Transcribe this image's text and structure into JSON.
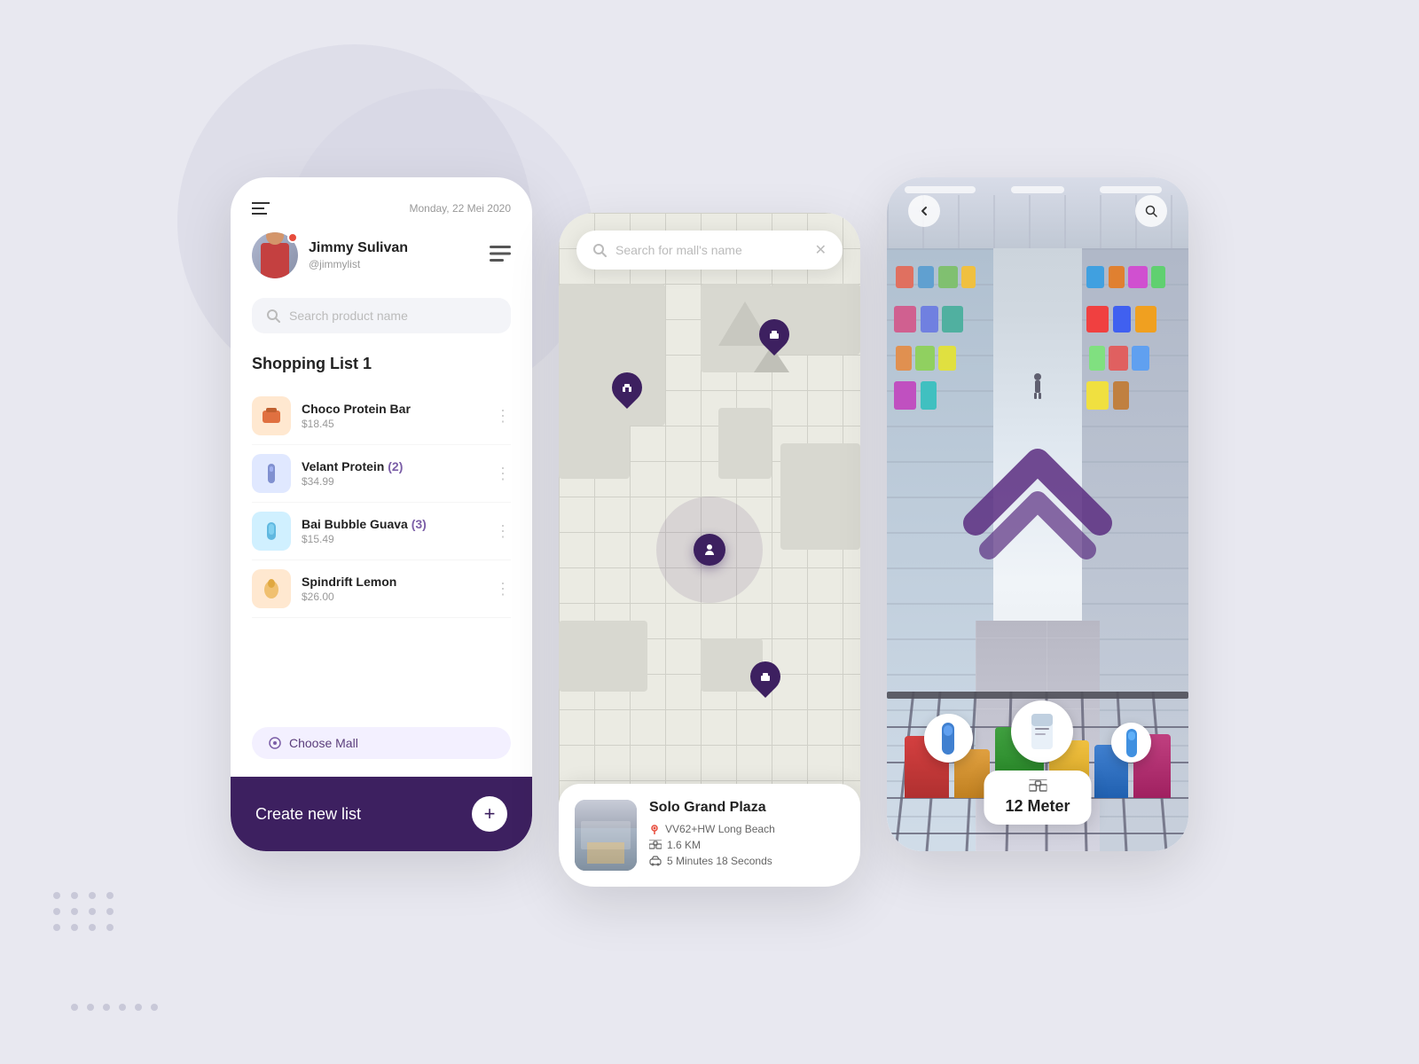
{
  "background": {
    "color": "#e8e8f0"
  },
  "phone1": {
    "header": {
      "hamburger_label": "menu",
      "date": "Monday, 22 Mei 2020"
    },
    "user": {
      "name": "Jimmy Sulivan",
      "handle": "@jimmylist"
    },
    "search": {
      "placeholder": "Search product name"
    },
    "shopping_list": {
      "title": "Shopping List 1",
      "items": [
        {
          "name": "Choco Protein Bar",
          "price": "$18.45",
          "count": null,
          "emoji": "🍫",
          "bg": "#ffe8d0"
        },
        {
          "name": "Velant Protein",
          "price": "$34.99",
          "count": "(2)",
          "emoji": "💊",
          "bg": "#e0e8ff"
        },
        {
          "name": "Bai Bubble Guava",
          "price": "$15.49",
          "count": "(3)",
          "emoji": "🥤",
          "bg": "#d0f0ff"
        },
        {
          "name": "Spindrift Lemon",
          "price": "$26.00",
          "count": null,
          "emoji": "🍋",
          "bg": "#ffe8d0"
        }
      ]
    },
    "choose_mall_btn": "Choose Mall",
    "footer": {
      "create_list": "Create new list",
      "add_btn": "+"
    }
  },
  "phone2": {
    "search": {
      "placeholder": "Search for mall's name"
    },
    "mall": {
      "name": "Solo Grand Plaza",
      "address": "VV62+HW Long Beach",
      "distance": "1.6 KM",
      "time": "5 Minutes 18 Seconds"
    }
  },
  "phone3": {
    "back_btn": "←",
    "search_btn": "🔍",
    "distance": {
      "value": "12 Meter",
      "icon": "🛒"
    }
  },
  "icons": {
    "search": "🔍",
    "pin": "🏪",
    "location": "📍",
    "route": "🗺️",
    "time": "⏱",
    "compass": "◎"
  }
}
